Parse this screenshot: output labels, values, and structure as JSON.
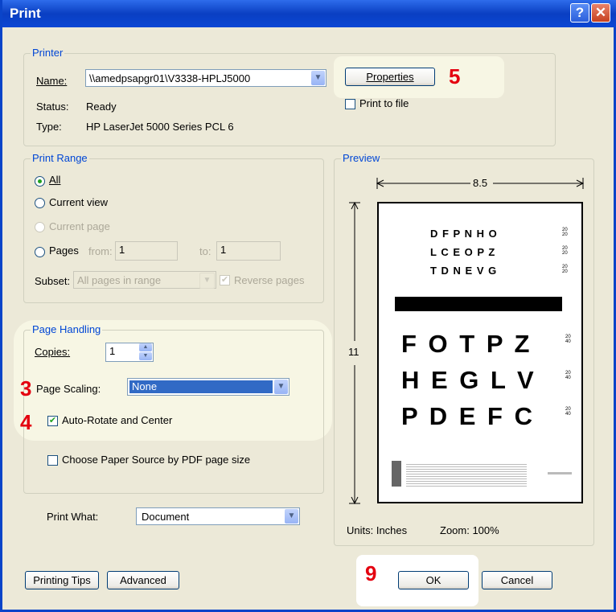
{
  "window": {
    "title": "Print",
    "help_glyph": "?",
    "close_glyph": "✕"
  },
  "printer": {
    "legend": "Printer",
    "name_label": "Name:",
    "name_value": "\\\\amedpsapgr01\\V3338-HPLJ5000",
    "status_label": "Status:",
    "status_value": "Ready",
    "type_label": "Type:",
    "type_value": "HP LaserJet 5000 Series PCL 6",
    "properties_label": "Properties",
    "print_to_file_label": "Print to file",
    "print_to_file_checked": false
  },
  "print_range": {
    "legend": "Print Range",
    "all_label": "All",
    "all_selected": true,
    "current_view_label": "Current view",
    "current_page_label": "Current page",
    "pages_label": "Pages",
    "from_label": "from:",
    "from_value": "1",
    "to_label": "to:",
    "to_value": "1",
    "subset_label": "Subset:",
    "subset_value": "All pages in range",
    "reverse_pages_label": "Reverse pages",
    "reverse_pages_checked": true
  },
  "page_handling": {
    "legend": "Page Handling",
    "copies_label": "Copies:",
    "copies_value": "1",
    "page_scaling_label": "Page Scaling:",
    "page_scaling_value": "None",
    "auto_rotate_label": "Auto-Rotate and Center",
    "auto_rotate_checked": true,
    "choose_paper_label": "Choose Paper Source by PDF page size",
    "choose_paper_checked": false
  },
  "print_what": {
    "label": "Print What:",
    "value": "Document"
  },
  "preview": {
    "legend": "Preview",
    "width_label": "8.5",
    "height_label": "11",
    "units_label": "Units: Inches",
    "zoom_label": "Zoom: 100%",
    "chart_rows": [
      {
        "letters": "D F P N H O",
        "frac_top": "20",
        "frac_bottom": "20"
      },
      {
        "letters": "L C E O P Z",
        "frac_top": "20",
        "frac_bottom": "20"
      },
      {
        "letters": "T D N E V G",
        "frac_top": "20",
        "frac_bottom": "20"
      },
      {
        "letters": "F O T P Z",
        "frac_top": "20",
        "frac_bottom": "40"
      },
      {
        "letters": "H E G L V",
        "frac_top": "20",
        "frac_bottom": "40"
      },
      {
        "letters": "P D E F C",
        "frac_top": "20",
        "frac_bottom": "40"
      }
    ]
  },
  "footer": {
    "printing_tips_label": "Printing Tips",
    "advanced_label": "Advanced",
    "ok_label": "OK",
    "cancel_label": "Cancel"
  },
  "callouts": {
    "properties": "5",
    "page_scaling": "3",
    "auto_rotate": "4",
    "ok": "9"
  },
  "colors": {
    "title_bar": "#0A44C9",
    "legend_text": "#0046D5",
    "callout": "#E4000F",
    "selection": "#316AC5",
    "highlight": "#F7F6E4"
  }
}
